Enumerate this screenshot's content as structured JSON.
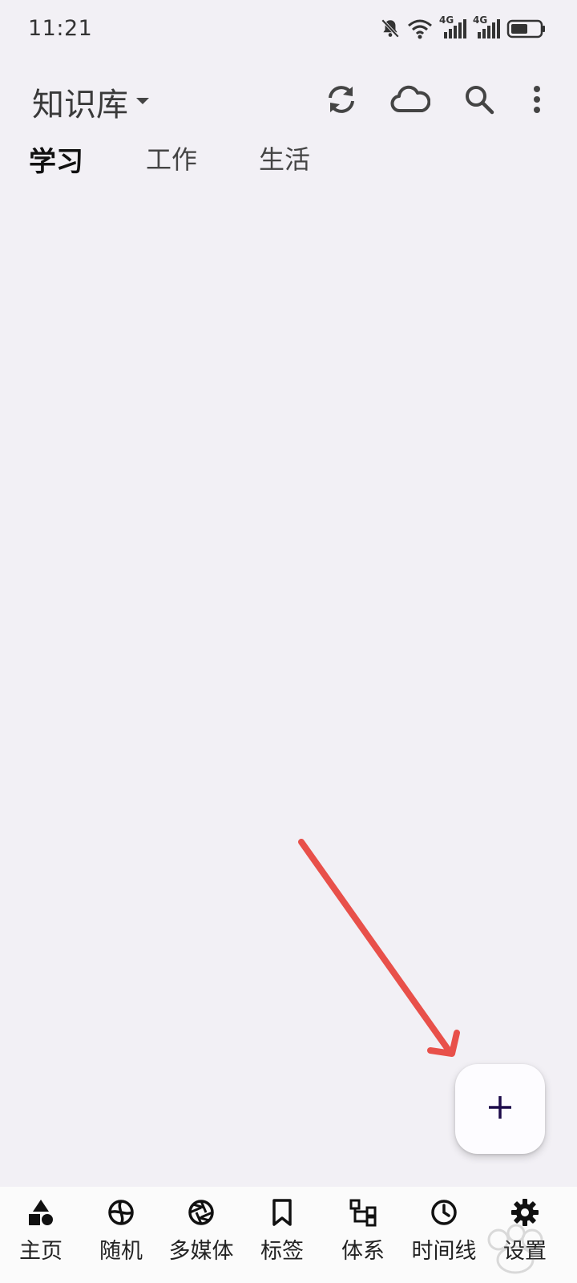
{
  "status_bar": {
    "time": "11:21",
    "signal_label_1": "4G",
    "signal_label_2": "4G",
    "icons": [
      "bell-off-icon",
      "wifi-icon",
      "signal-4g-icon",
      "signal-4g-icon",
      "battery-icon"
    ]
  },
  "app_bar": {
    "title": "知识库",
    "actions": [
      "sync-icon",
      "cloud-icon",
      "search-icon",
      "more-vert-icon"
    ]
  },
  "tabs": [
    {
      "label": "学习",
      "active": true
    },
    {
      "label": "工作",
      "active": false
    },
    {
      "label": "生活",
      "active": false
    }
  ],
  "fab": {
    "icon": "plus-icon"
  },
  "bottom_nav": {
    "items": [
      {
        "label": "主页",
        "icon": "shapes-icon"
      },
      {
        "label": "随机",
        "icon": "random-icon"
      },
      {
        "label": "多媒体",
        "icon": "aperture-icon"
      },
      {
        "label": "标签",
        "icon": "bookmark-icon"
      },
      {
        "label": "体系",
        "icon": "hierarchy-icon"
      },
      {
        "label": "时间线",
        "icon": "clock-icon"
      },
      {
        "label": "设置",
        "icon": "gear-icon"
      }
    ]
  },
  "colors": {
    "background": "#f2f0f5",
    "fab_icon": "#1d0b4a",
    "annotation_arrow": "#e8504a"
  }
}
